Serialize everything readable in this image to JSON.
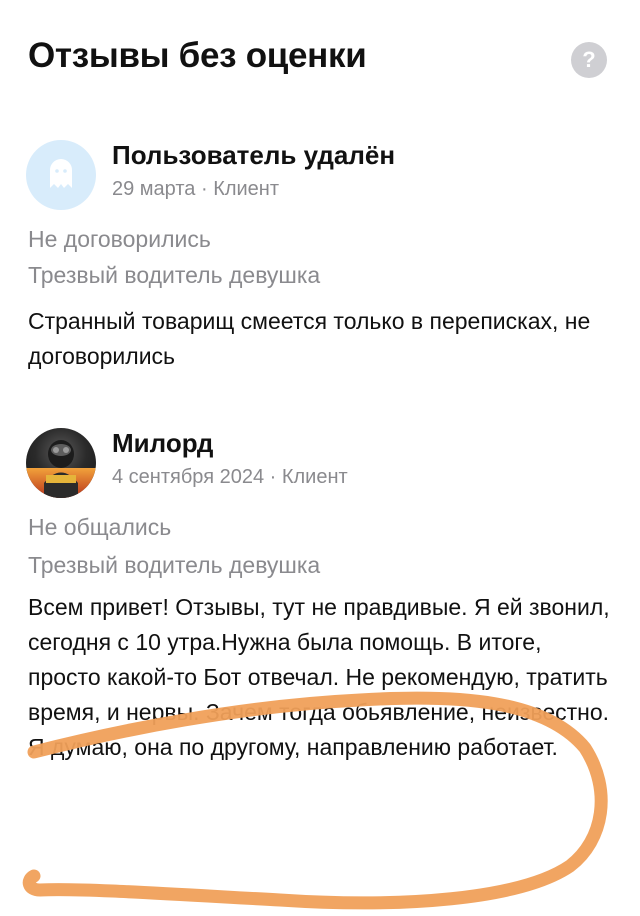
{
  "header": {
    "title": "Отзывы без оценки",
    "help_icon": "?"
  },
  "reviews": [
    {
      "author": "Пользователь удалён",
      "meta": "29 марта · Клиент",
      "avatar_icon": "ghost-icon",
      "status": "Не договорились",
      "service": "Трезвый водитель девушка",
      "text": "Странный товарищ смеется только в переписках, не договорились"
    },
    {
      "author": "Милорд",
      "meta": "4 сентября 2024 · Клиент",
      "avatar_icon": "user-photo",
      "avatar_text": "AVTOBOT",
      "status": "Не общались",
      "service": "Трезвый водитель девушка",
      "text": "Всем привет! Отзывы, тут не правдивые. Я ей звонил, сегодня с 10 утра.Нужна была помощь. В итоге, просто какой-то Бот отвечал. Не рекомендую, тратить время, и нервы. Зачем тогда обьявление, неизвестно. Я думаю, она по другому, направлению работает."
    }
  ],
  "colors": {
    "text_primary": "#111111",
    "text_secondary": "#8a8a8e",
    "ghost_avatar_bg": "#d8ecfb",
    "help_icon_bg": "#cfcfd3",
    "annotation_stroke": "#f0a05a"
  }
}
